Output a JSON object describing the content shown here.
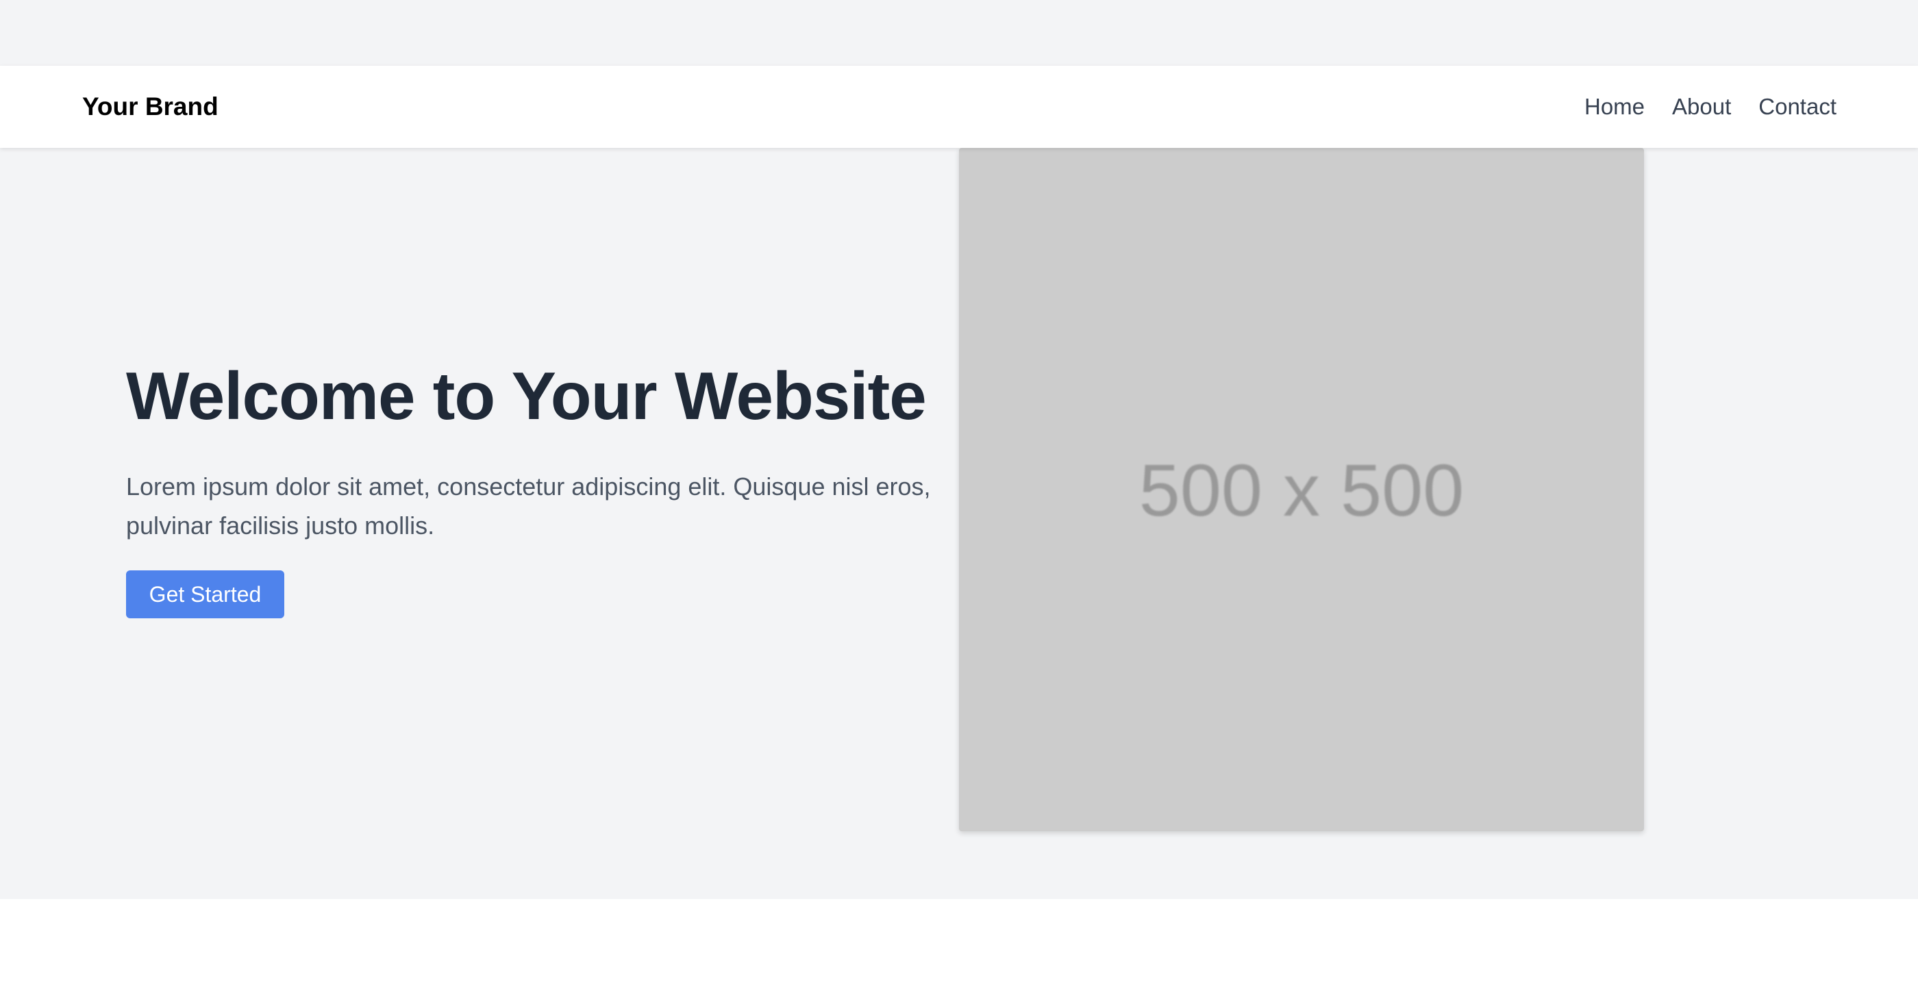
{
  "nav": {
    "brand": "Your Brand",
    "links": [
      "Home",
      "About",
      "Contact"
    ]
  },
  "hero": {
    "title": "Welcome to Your Website",
    "text": "Lorem ipsum dolor sit amet, consectetur adipiscing elit. Quisque nisl eros, pulvinar facilisis justo mollis.",
    "button": "Get Started",
    "image_placeholder": "500 x 500"
  },
  "colors": {
    "accent": "#4f83ec",
    "hero_bg": "#f3f4f6",
    "heading": "#1f2937"
  }
}
